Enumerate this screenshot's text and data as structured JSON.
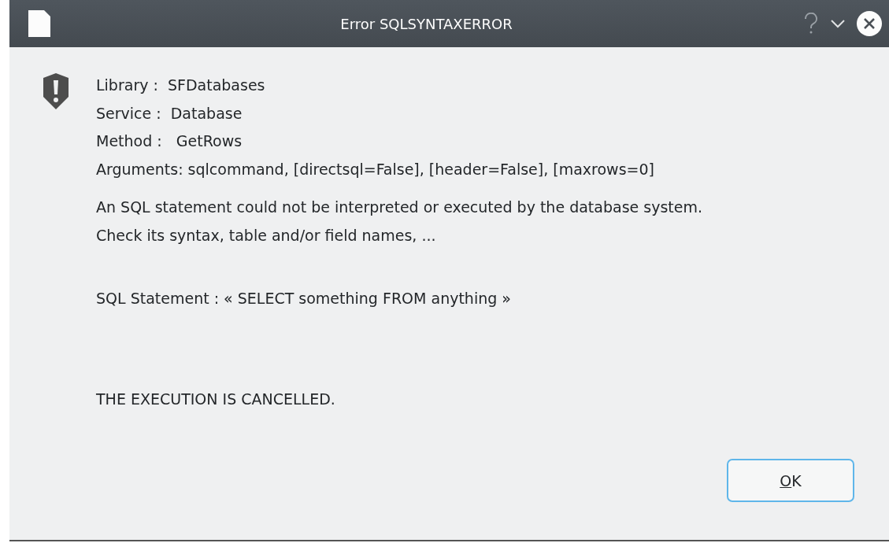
{
  "window": {
    "title": "Error SQLSYNTAXERROR"
  },
  "message": {
    "groups": [
      [
        "Library :  SFDatabases",
        "Service :  Database",
        "Method :   GetRows",
        "Arguments: sqlcommand, [directsql=False], [header=False], [maxrows=0]"
      ],
      [
        "An SQL statement could not be interpreted or executed by the database system.",
        "Check its syntax, table and/or field names, ..."
      ],
      [
        "SQL Statement : « SELECT something FROM anything »"
      ],
      [
        "THE EXECUTION IS CANCELLED."
      ]
    ]
  },
  "buttons": [
    {
      "label": "OK",
      "mnemonic_first_letter": true,
      "focused": true
    }
  ]
}
